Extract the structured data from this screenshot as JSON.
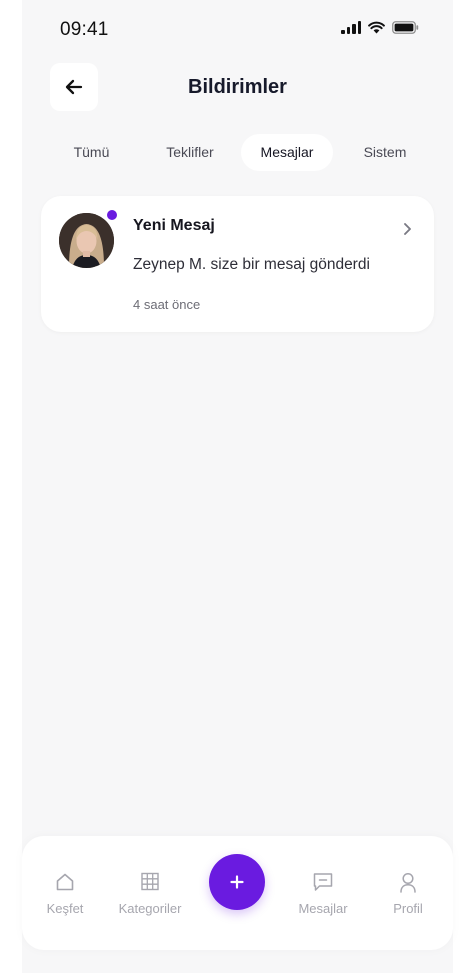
{
  "status_bar": {
    "time": "09:41"
  },
  "header": {
    "title": "Bildirimler"
  },
  "tabs": [
    {
      "label": "Tümü",
      "active": false
    },
    {
      "label": "Teklifler",
      "active": false
    },
    {
      "label": "Mesajlar",
      "active": true
    },
    {
      "label": "Sistem",
      "active": false
    }
  ],
  "notifications": [
    {
      "title": "Yeni Mesaj",
      "body": "Zeynep M. size bir mesaj gönderdi",
      "time": "4 saat önce",
      "unread": true
    }
  ],
  "bottom_nav": {
    "items": [
      {
        "label": "Keşfet",
        "icon": "home-icon"
      },
      {
        "label": "Kategoriler",
        "icon": "grid-icon"
      },
      {
        "label": "Mesajlar",
        "icon": "message-icon"
      },
      {
        "label": "Profil",
        "icon": "user-icon"
      }
    ],
    "fab_icon": "plus-icon"
  },
  "colors": {
    "accent": "#6a1be0",
    "background": "#f7f7f8",
    "card": "#ffffff",
    "muted_text": "#a6a6ae"
  }
}
